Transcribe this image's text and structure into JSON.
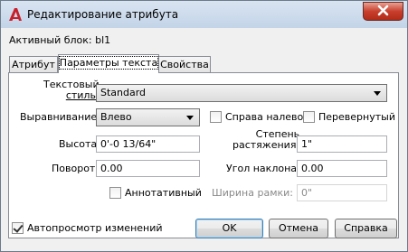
{
  "window": {
    "title": "Редактирование атрибута"
  },
  "block": {
    "label": "Активный блок: bl1"
  },
  "tabs": [
    {
      "label": "Атрибут"
    },
    {
      "label": "Параметры текста"
    },
    {
      "label": "Свойства"
    }
  ],
  "text_style": {
    "label_line1": "Текстовый",
    "label_line2": "стиль:",
    "value": "Standard"
  },
  "justification": {
    "label": "Выравнивание:",
    "value": "Влево"
  },
  "backwards": {
    "label": "Справа налево",
    "checked": false
  },
  "upside_down": {
    "label": "Перевернутый",
    "checked": false
  },
  "height": {
    "label": "Высота:",
    "value": "0'-0 13/64\""
  },
  "width_factor": {
    "label_line1": "Степень",
    "label_line2": "растяжения:",
    "value": "1\""
  },
  "rotation": {
    "label": "Поворот:",
    "value": "0.00"
  },
  "oblique_angle": {
    "label": "Угол наклона:",
    "value": "0.00"
  },
  "annotative": {
    "label": "Аннотативный",
    "checked": false
  },
  "boundary_width": {
    "label": "Ширина рамки:",
    "value": "0\"",
    "disabled": true
  },
  "auto_preview": {
    "label": "Автопросмотр изменений",
    "checked": true
  },
  "buttons": {
    "ok": "OK",
    "cancel": "Отмена",
    "help": "Справка"
  }
}
